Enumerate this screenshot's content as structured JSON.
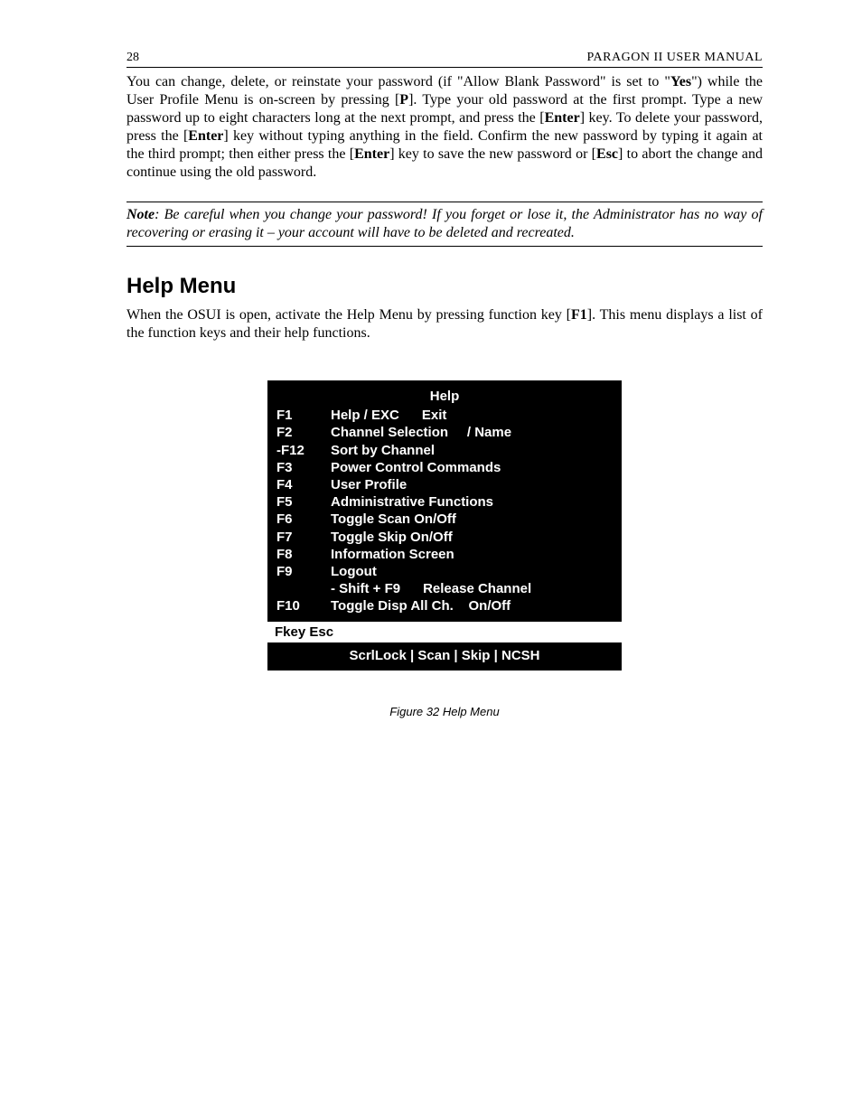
{
  "header": {
    "page_number": "28",
    "doc_title": "PARAGON II USER MANUAL"
  },
  "paragraph1": {
    "t1": "You can change, delete, or reinstate your password (if \"Allow Blank Password\" is set to \"",
    "yes": "Yes",
    "t2": "\") while the User Profile Menu is on-screen by pressing [",
    "p": "P",
    "t3": "]. Type your old password at the first prompt. Type a new password up to eight characters long at the next prompt, and press the [",
    "enter1": "Enter",
    "t4": "] key. To delete your password, press the [",
    "enter2": "Enter",
    "t5": "] key without typing anything in the field. Confirm the new password by typing it again at the third prompt; then either press the [",
    "enter3": "Enter",
    "t6": "] key to save the new password or [",
    "esc": "Esc",
    "t7": "] to abort the change and continue using the old password."
  },
  "note": {
    "label": "Note",
    "text": ": Be careful when you change your password! If you forget or lose it, the Administrator has no way of recovering or erasing it – your account will have to be deleted and recreated."
  },
  "section_title": "Help Menu",
  "paragraph2": {
    "t1": "When the OSUI is open, activate the Help Menu by pressing function key [",
    "f1": "F1",
    "t2": "]. This menu displays a list of the function keys and their help functions."
  },
  "help_menu": {
    "title": "Help",
    "rows": [
      {
        "key": "F1",
        "desc": "Help / EXC      Exit"
      },
      {
        "key": "F2",
        "desc": "Channel Selection     / Name"
      },
      {
        "key": "-F12",
        "desc": "Sort by Channel"
      },
      {
        "key": "F3",
        "desc": "Power Control Commands"
      },
      {
        "key": "F4",
        "desc": "User Profile"
      },
      {
        "key": "F5",
        "desc": "Administrative Functions"
      },
      {
        "key": "F6",
        "desc": "Toggle Scan On/Off"
      },
      {
        "key": "F7",
        "desc": "Toggle Skip On/Off"
      },
      {
        "key": "F8",
        "desc": "Information Screen"
      },
      {
        "key": "F9",
        "desc": "Logout"
      },
      {
        "key": "",
        "desc": "- Shift + F9      Release Channel"
      },
      {
        "key": "F10",
        "desc": "Toggle Disp All Ch.    On/Off"
      }
    ],
    "fkey_bar": "Fkey   Esc",
    "status_bar": "ScrlLock   |    Scan   |    Skip    |   NCSH"
  },
  "figure_caption": "Figure 32 Help Menu"
}
